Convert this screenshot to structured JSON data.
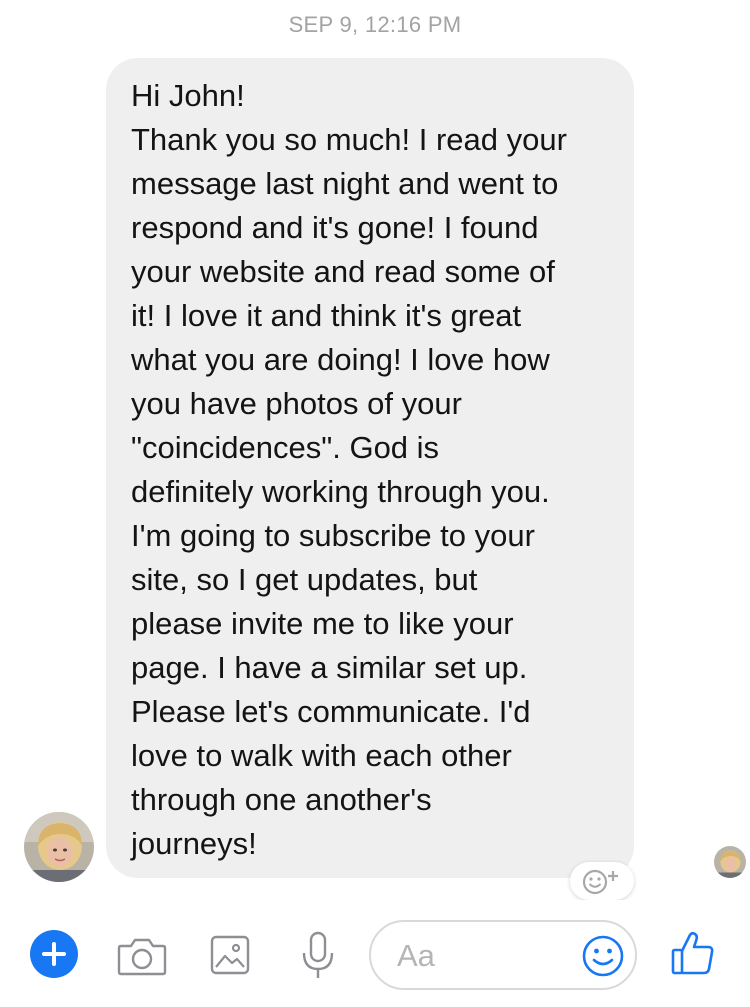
{
  "timestamp": "SEP 9, 12:16 PM",
  "message": {
    "lines": [
      "Hi John!",
      "Thank you so much! I read your",
      "message last night and went to",
      "respond and it's gone! I found",
      "your website and read some of",
      "it! I love it and think it's great",
      "what you are doing! I love how",
      "you have photos of your",
      "\"coincidences\". God is",
      "definitely working through you.",
      "I'm going to subscribe to your",
      "site, so I get updates, but",
      "please invite me to like your",
      "page. I have a similar set up.",
      "Please let's communicate. I'd",
      "love to walk with each other",
      "through one another's",
      "journeys!"
    ]
  },
  "composer": {
    "placeholder": "Aa",
    "icons": [
      "plus-icon",
      "camera-icon",
      "image-icon",
      "microphone-icon",
      "emoji-icon",
      "thumbs-up-icon"
    ]
  },
  "colors": {
    "accent": "#1877f2",
    "bubble": "#efeff0",
    "timestamp": "#a3a3a6"
  }
}
